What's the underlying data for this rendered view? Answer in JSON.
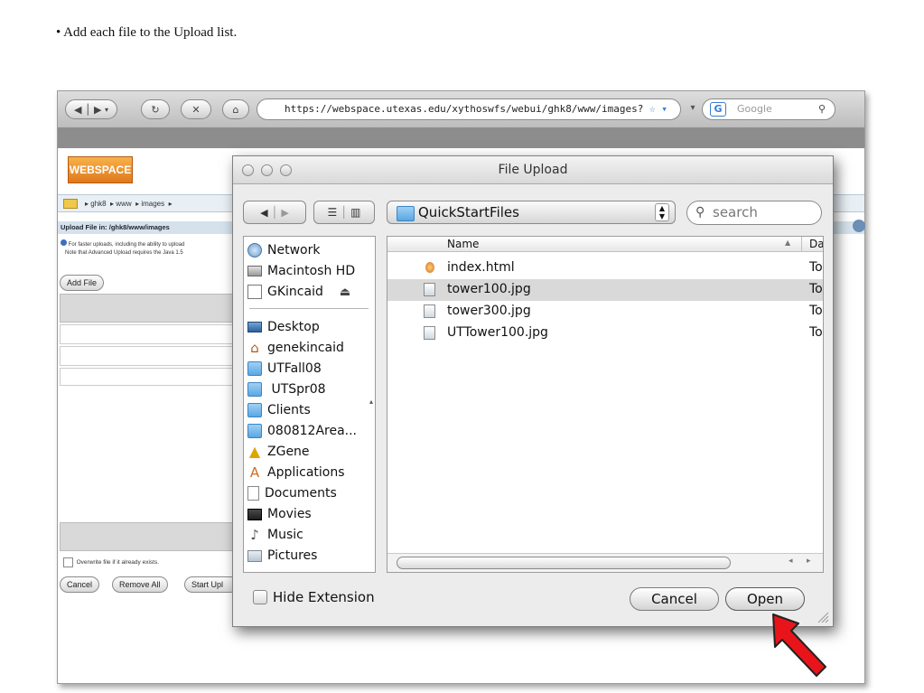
{
  "caption": "• Add each file to the Upload list.",
  "browser": {
    "url": "https://webspace.utexas.edu/xythoswfs/webui/ghk8/www/images?",
    "search_placeholder": "Google"
  },
  "webpage": {
    "logo_text": "WEBSPACE",
    "breadcrumb": [
      "ghk8",
      "www",
      "images"
    ],
    "upload_header": "Upload File in:  /ghk8/www/images",
    "note_line1": "For faster uploads, including the ability to upload",
    "note_line2": "Note that Advanced Upload requires the Java 1.5",
    "add_file_label": "Add File",
    "overwrite_label": "Overwrite file if it already exists.",
    "buttons": [
      "Cancel",
      "Remove All",
      "Start Upl"
    ]
  },
  "dialog": {
    "title": "File Upload",
    "location": "QuickStartFiles",
    "search_placeholder": "search",
    "sidebar_devices": [
      {
        "label": "Network",
        "icon": "network-icon"
      },
      {
        "label": "Macintosh HD",
        "icon": "hard-drive-icon"
      },
      {
        "label": "GKincaid",
        "icon": "drive-icon"
      }
    ],
    "sidebar_places": [
      {
        "label": "Desktop",
        "icon": "desktop-icon"
      },
      {
        "label": "genekincaid",
        "icon": "home-icon"
      },
      {
        "label": "UTFall08",
        "icon": "folder-icon"
      },
      {
        "label": " UTSpr08",
        "icon": "folder-icon"
      },
      {
        "label": "Clients",
        "icon": "folder-icon"
      },
      {
        "label": "080812Area...",
        "icon": "folder-icon"
      },
      {
        "label": "ZGene",
        "icon": "warning-icon"
      },
      {
        "label": "Applications",
        "icon": "applications-icon"
      },
      {
        "label": "Documents",
        "icon": "documents-icon"
      },
      {
        "label": "Movies",
        "icon": "movies-icon"
      },
      {
        "label": "Music",
        "icon": "music-icon"
      },
      {
        "label": "Pictures",
        "icon": "pictures-icon"
      }
    ],
    "columns": {
      "name": "Name",
      "date": "Da"
    },
    "files": [
      {
        "name": "index.html",
        "date": "To",
        "selected": false
      },
      {
        "name": "tower100.jpg",
        "date": "To",
        "selected": true
      },
      {
        "name": "tower300.jpg",
        "date": "To",
        "selected": false
      },
      {
        "name": "UTTower100.jpg",
        "date": "To",
        "selected": false
      }
    ],
    "hide_extension_label": "Hide Extension",
    "cancel_label": "Cancel",
    "open_label": "Open"
  },
  "colors": {
    "arrow": "#e8141a",
    "selection": "#d9d9d9"
  }
}
